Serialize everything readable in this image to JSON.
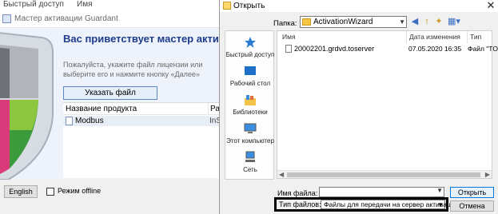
{
  "background": {
    "left_text": "Быстрый доступ",
    "col_text": "Имя"
  },
  "wizard": {
    "title": "Мастер активации Guardant",
    "heading": "Вас приветствует мастер активации лицензий",
    "description": "Пожалуйста, укажите файл лицензии или выберите его и нажмите кнопку «Далее»",
    "license_button": "Указать файл лицензии...",
    "table": {
      "col_product": "Название продукта",
      "col_status": "Раз",
      "rows": [
        {
          "name": "Modbus",
          "status": "InS"
        }
      ]
    },
    "language_button": "English",
    "offline_label": "Режим offline"
  },
  "dialog": {
    "title": "Открыть",
    "close": "✕",
    "folder_label": "Папка:",
    "folder_value": "ActivationWizard",
    "places": [
      {
        "label": "Быстрый доступ",
        "icon": "quick-access-star-icon"
      },
      {
        "label": "Рабочий стол",
        "icon": "desktop-icon"
      },
      {
        "label": "Библиотеки",
        "icon": "libraries-icon"
      },
      {
        "label": "Этот компьютер",
        "icon": "computer-icon"
      },
      {
        "label": "Сеть",
        "icon": "network-icon"
      }
    ],
    "columns": {
      "name": "Имя",
      "date": "Дата изменения",
      "type": "Тип"
    },
    "files": [
      {
        "name": "20002201.grdvd.toserver",
        "date": "07.05.2020 16:35",
        "type": "Файл \"TO"
      }
    ],
    "filename_label": "Имя файла:",
    "filename_value": "",
    "filetype_label": "Тип файлов:",
    "filetype_value": "Файлы для передачи на сервер активации",
    "open_button": "Открыть",
    "cancel_button": "Отмена"
  }
}
